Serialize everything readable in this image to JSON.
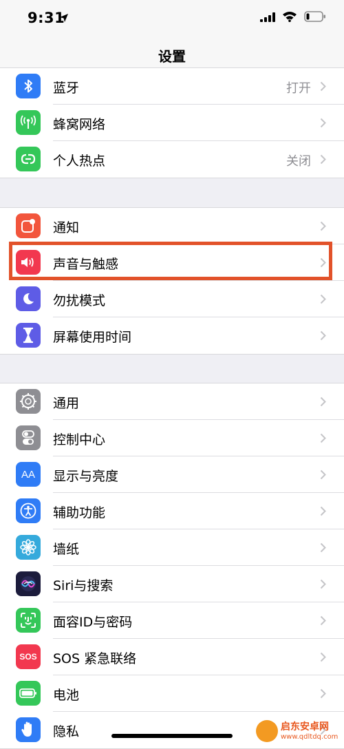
{
  "status_bar": {
    "time": "9:31"
  },
  "nav": {
    "title": "设置"
  },
  "groups": [
    [
      {
        "label": "蓝牙",
        "value": "打开",
        "icon": "bluetooth-icon",
        "color": "#2f7cf6"
      },
      {
        "label": "蜂窝网络",
        "value": "",
        "icon": "cellular-antenna-icon",
        "color": "#34c759"
      },
      {
        "label": "个人热点",
        "value": "关闭",
        "icon": "personal-hotspot-icon",
        "color": "#34c759"
      }
    ],
    [
      {
        "label": "通知",
        "icon": "notifications-icon",
        "color": "#f2553c"
      },
      {
        "label": "声音与触感",
        "icon": "speaker-icon",
        "color": "#f2384f"
      },
      {
        "label": "勿扰模式",
        "icon": "moon-icon",
        "color": "#5e5ce6"
      },
      {
        "label": "屏幕使用时间",
        "icon": "hourglass-icon",
        "color": "#5e5ce6"
      }
    ],
    [
      {
        "label": "通用",
        "icon": "gear-icon",
        "color": "#8e8e93"
      },
      {
        "label": "控制中心",
        "icon": "toggles-icon",
        "color": "#8e8e93"
      },
      {
        "label": "显示与亮度",
        "icon": "aa-text-icon",
        "color": "#2f7cf6"
      },
      {
        "label": "辅助功能",
        "icon": "accessibility-icon",
        "color": "#2f7cf6"
      },
      {
        "label": "墙纸",
        "icon": "flower-icon",
        "color": "#35aadc"
      },
      {
        "label": "Siri与搜索",
        "icon": "siri-icon",
        "color": "#1c1c3c"
      },
      {
        "label": "面容ID与密码",
        "icon": "face-id-icon",
        "color": "#34c759"
      },
      {
        "label": "SOS 紧急联络",
        "icon": "sos-icon",
        "color": "#f2384f"
      },
      {
        "label": "电池",
        "icon": "battery-icon",
        "color": "#34c759"
      },
      {
        "label": "隐私",
        "icon": "hand-icon",
        "color": "#2f7cf6"
      }
    ]
  ],
  "sos_icon_text": "SOS",
  "display_icon_text": "AA",
  "watermark": {
    "name": "启东安卓网",
    "url": "www.qdltdq.com"
  },
  "highlight_color": "#e2522a"
}
